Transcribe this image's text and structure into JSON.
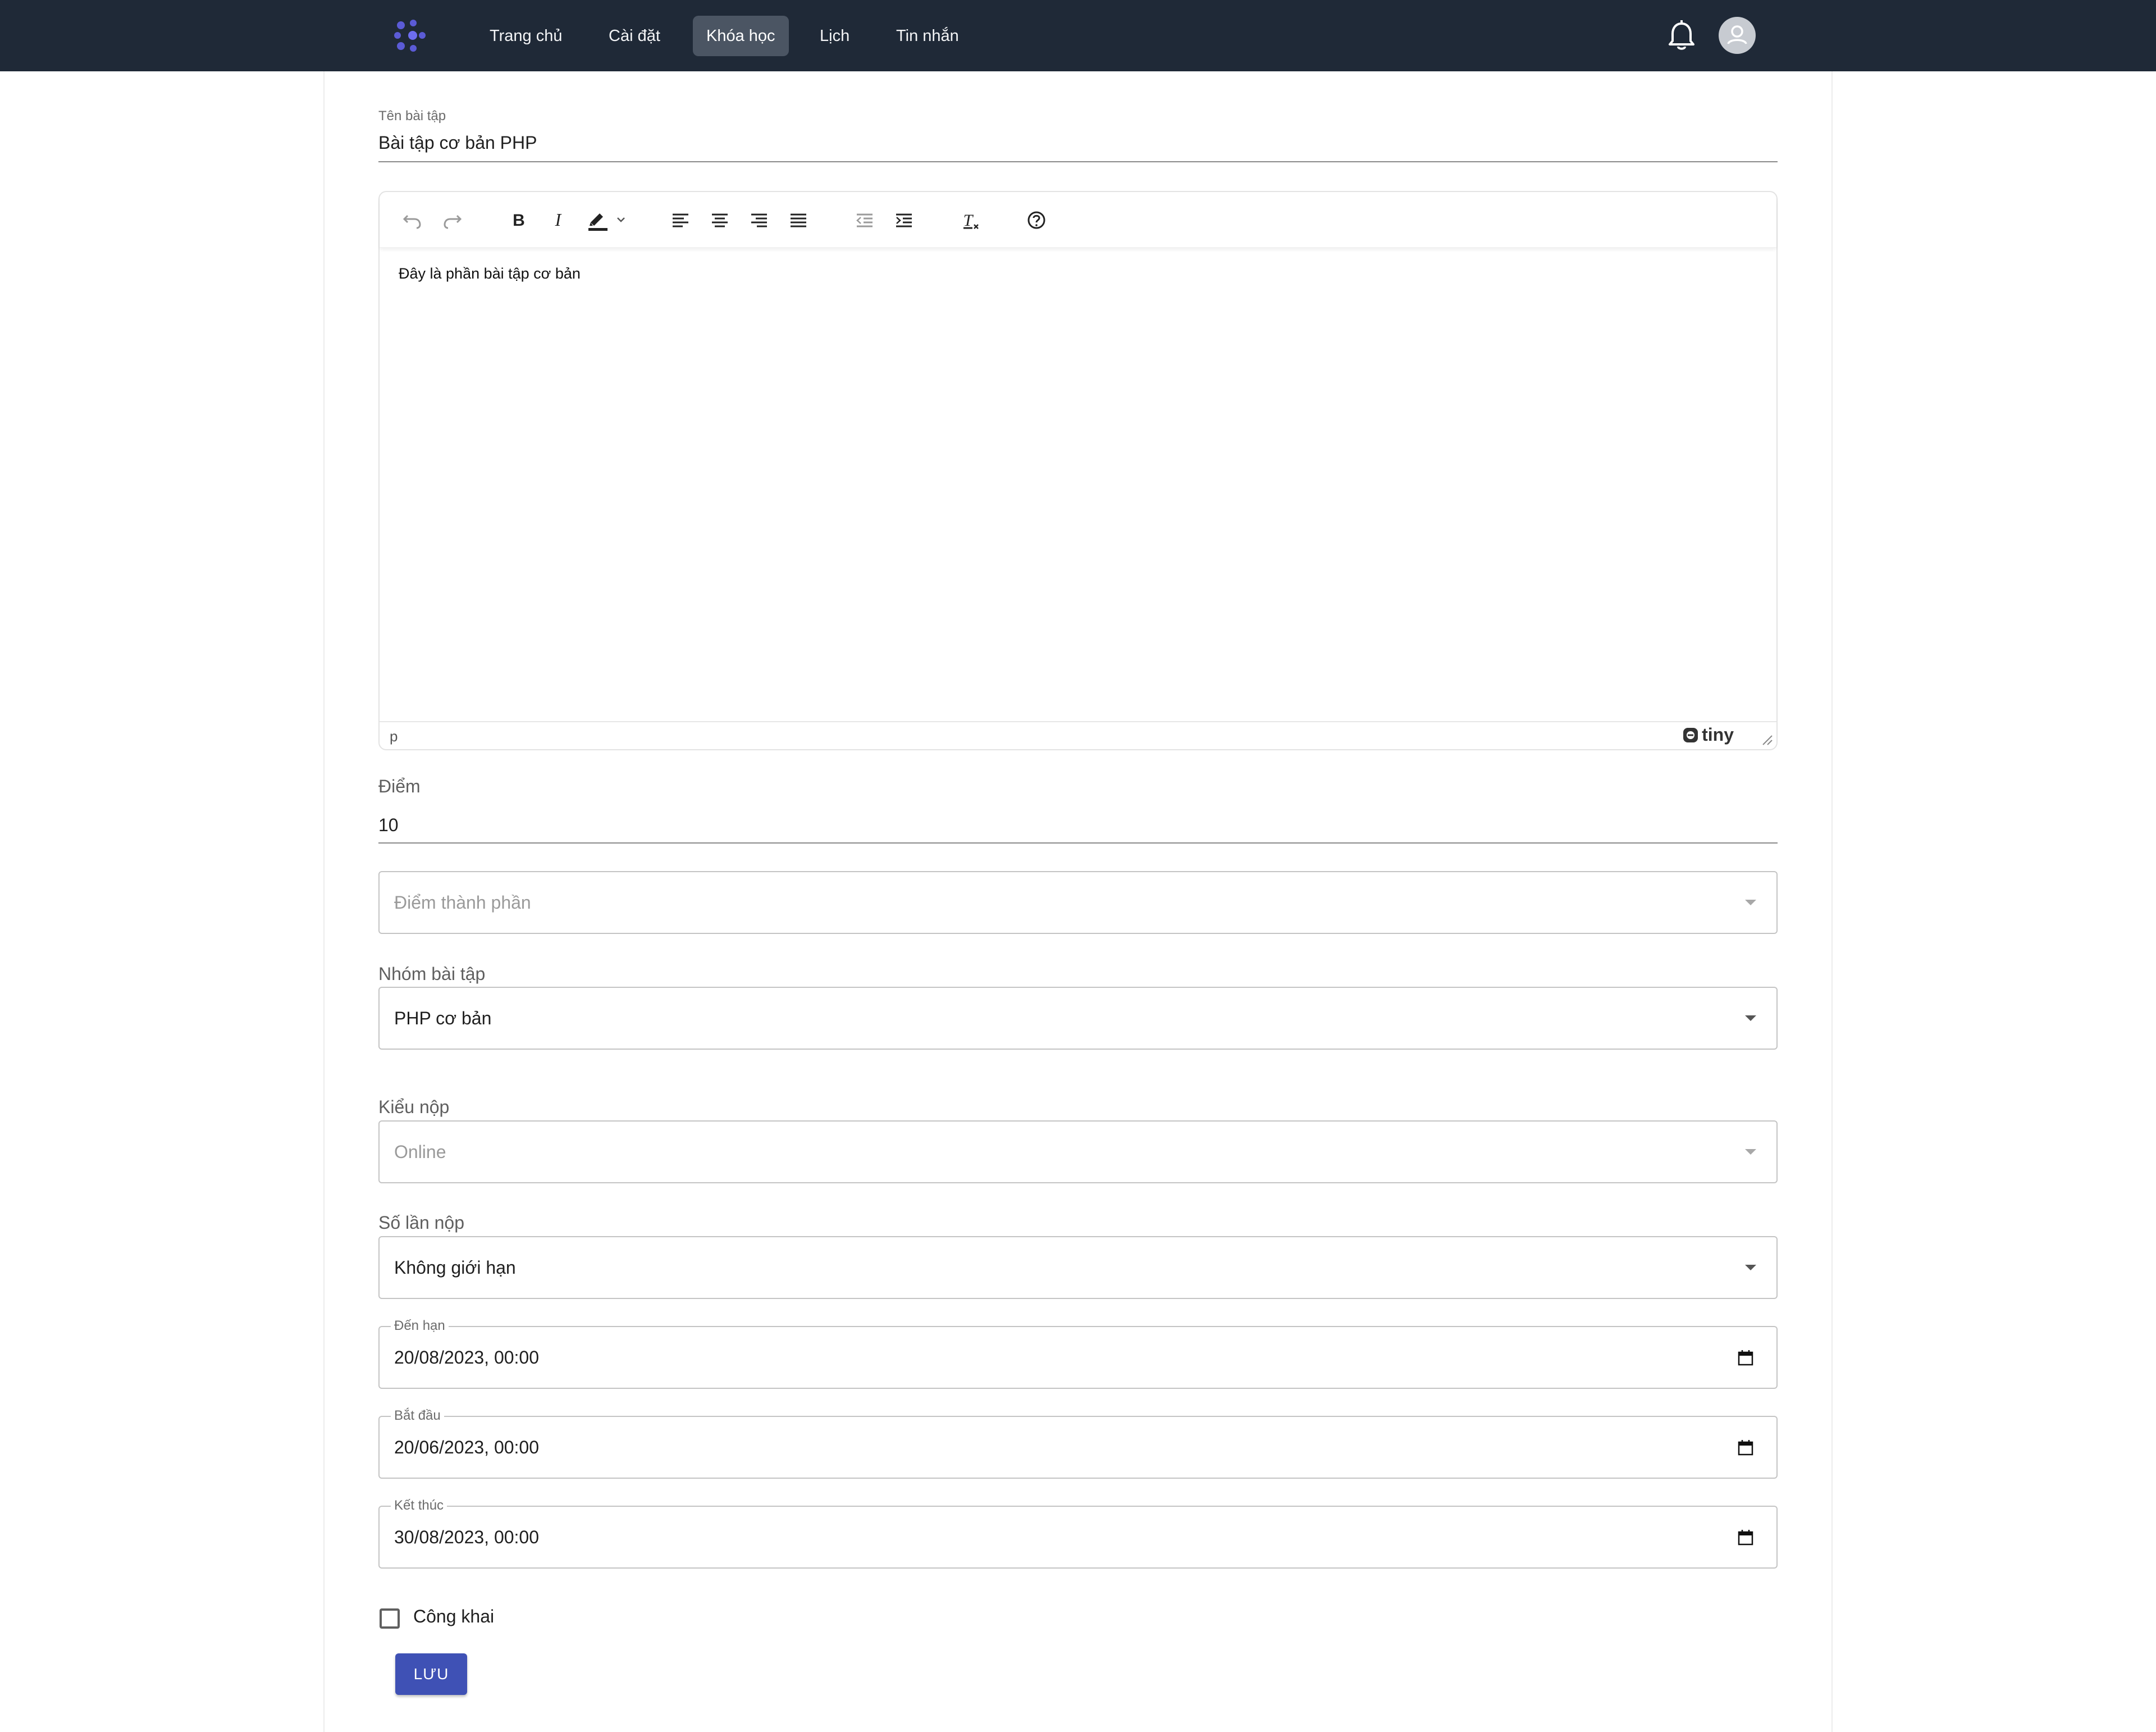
{
  "nav": {
    "items": [
      {
        "label": "Trang chủ"
      },
      {
        "label": "Cài đặt"
      },
      {
        "label": "Khóa học"
      },
      {
        "label": "Lịch"
      },
      {
        "label": "Tin nhắn"
      }
    ],
    "active": "Khóa học"
  },
  "form": {
    "title_label": "Tên bài tập",
    "title_value": "Bài tập cơ bản PHP",
    "editor": {
      "content": "Đây là phần bài tập cơ bản",
      "path": "p",
      "brand": "tiny",
      "toolbar": [
        "undo-icon",
        "redo-icon",
        "bold-icon",
        "italic-icon",
        "highlight-icon",
        "align-left-icon",
        "align-center-icon",
        "align-right-icon",
        "align-justify-icon",
        "outdent-icon",
        "indent-icon",
        "clear-format-icon",
        "help-icon"
      ]
    },
    "score_label": "Điểm",
    "score_value": "10",
    "component_placeholder": "Điểm thành phần",
    "group_label": "Nhóm bài tập",
    "group_value": "PHP cơ bản",
    "submit_type_label": "Kiểu nộp",
    "submit_type_value": "Online",
    "attempts_label": "Số lần nộp",
    "attempts_value": "Không giới hạn",
    "due_label": "Đến hạn",
    "due_value": "20/08/2023, 00:00",
    "start_label": "Bắt đầu",
    "start_value": "20/06/2023, 00:00",
    "end_label": "Kết thúc",
    "end_value": "30/08/2023, 00:00",
    "public_label": "Công khai",
    "save_label": "LƯU"
  },
  "colors": {
    "topbar": "#1f2937",
    "active_nav": "#4b5563",
    "logo": "#5b5bd6",
    "primary_button": "#3f51b5"
  }
}
